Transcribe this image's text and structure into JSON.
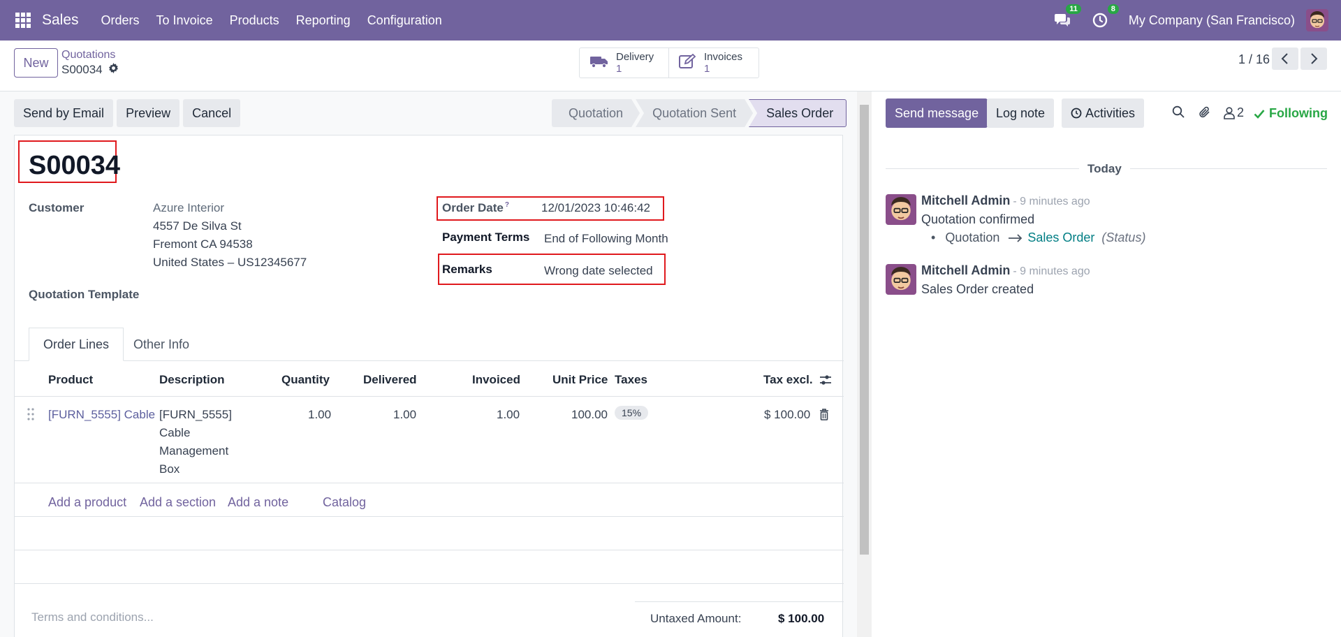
{
  "navbar": {
    "brand": "Sales",
    "menu": [
      "Orders",
      "To Invoice",
      "Products",
      "Reporting",
      "Configuration"
    ],
    "messages_count": "11",
    "activities_count": "8",
    "company": "My Company (San Francisco)"
  },
  "control": {
    "new_label": "New",
    "breadcrumb_parent": "Quotations",
    "breadcrumb_current": "S00034",
    "smart_buttons": [
      {
        "label": "Delivery",
        "value": "1",
        "icon": "truck-icon"
      },
      {
        "label": "Invoices",
        "value": "1",
        "icon": "invoice-edit-icon"
      }
    ],
    "pager": "1 / 16"
  },
  "form": {
    "actions": [
      "Send by Email",
      "Preview",
      "Cancel"
    ],
    "stages": [
      "Quotation",
      "Quotation Sent",
      "Sales Order"
    ],
    "active_stage": "Sales Order",
    "order_name": "S00034",
    "customer_label": "Customer",
    "customer_name": "Azure Interior",
    "customer_address": [
      "4557 De Silva St",
      "Fremont CA 94538",
      "United States – US12345677"
    ],
    "template_label": "Quotation Template",
    "order_date_label": "Order Date",
    "order_date_help": "?",
    "order_date": "12/01/2023 10:46:42",
    "payment_terms_label": "Payment Terms",
    "payment_terms": "End of Following Month",
    "remarks_label": "Remarks",
    "remarks": "Wrong date selected",
    "tabs": [
      "Order Lines",
      "Other Info"
    ],
    "columns": [
      "Product",
      "Description",
      "Quantity",
      "Delivered",
      "Invoiced",
      "Unit Price",
      "Taxes",
      "Tax excl."
    ],
    "lines": [
      {
        "product": "[FURN_5555] Cable",
        "description": [
          "[FURN_5555]",
          "Cable",
          "Management",
          "Box"
        ],
        "quantity": "1.00",
        "delivered": "1.00",
        "invoiced": "1.00",
        "unit_price": "100.00",
        "taxes": "15%",
        "subtotal": "$ 100.00"
      }
    ],
    "add_links": [
      "Add a product",
      "Add a section",
      "Add a note",
      "Catalog"
    ],
    "terms_placeholder": "Terms and conditions...",
    "untaxed_label": "Untaxed Amount:",
    "untaxed_value": "$ 100.00"
  },
  "chatter": {
    "send_message": "Send message",
    "log_note": "Log note",
    "activities": "Activities",
    "followers_count": "2",
    "following": "Following",
    "today": "Today",
    "messages": [
      {
        "author": "Mitchell Admin",
        "time": "- 9 minutes ago",
        "body": "Quotation confirmed",
        "tracking_old": "Quotation",
        "tracking_new": "Sales Order",
        "tracking_field": "(Status)"
      },
      {
        "author": "Mitchell Admin",
        "time": "- 9 minutes ago",
        "body": "Sales Order created"
      }
    ]
  },
  "colors": {
    "brand": "#71639e",
    "highlight_box": "#e0191d",
    "following": "#28a745",
    "tracking_new": "#017e84"
  }
}
